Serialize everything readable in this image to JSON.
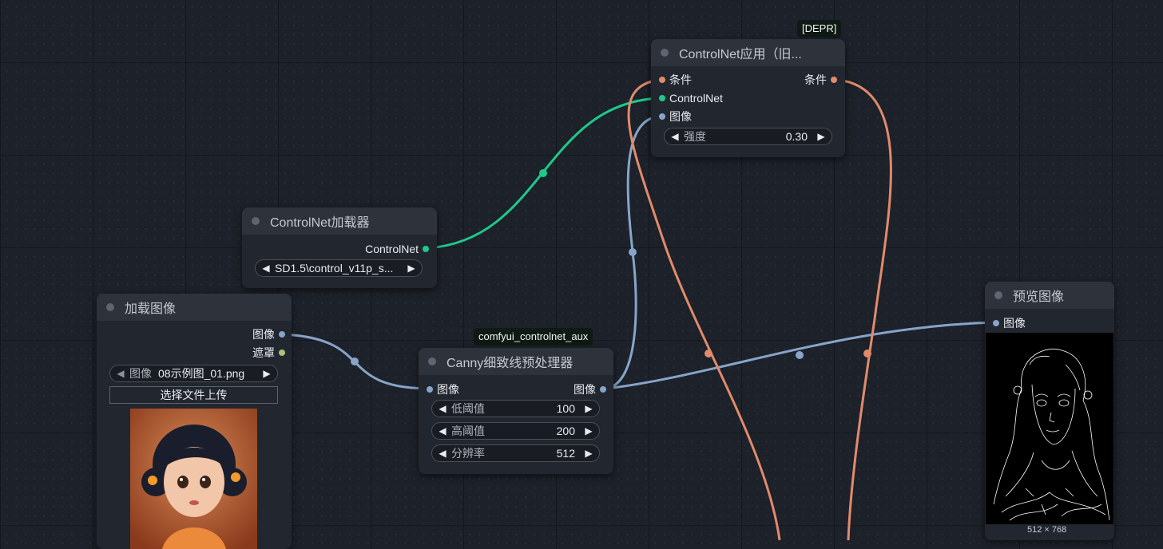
{
  "colors": {
    "conditioning": "#e08b6c",
    "controlnet": "#1ec98c",
    "image": "#86a5c8",
    "mask": "#a8c37a"
  },
  "nodes": {
    "controlnet_apply": {
      "badge": "[DEPR]",
      "title": "ControlNet应用（旧...",
      "inputs": [
        "条件",
        "ControlNet",
        "图像"
      ],
      "outputs": [
        "条件"
      ],
      "widgets": [
        {
          "label": "强度",
          "value": "0.30"
        }
      ]
    },
    "controlnet_loader": {
      "title": "ControlNet加载器",
      "outputs": [
        "ControlNet"
      ],
      "widgets": [
        {
          "label": "",
          "value": "SD1.5\\control_v11p_s..."
        }
      ]
    },
    "load_image": {
      "title": "加载图像",
      "outputs": [
        "图像",
        "遮罩"
      ],
      "widgets": [
        {
          "label": "图像",
          "value": "08示例图_01.png"
        }
      ],
      "upload_button": "选择文件上传"
    },
    "canny": {
      "badge": "comfyui_controlnet_aux",
      "title": "Canny细致线预处理器",
      "inputs": [
        "图像"
      ],
      "outputs": [
        "图像"
      ],
      "widgets": [
        {
          "label": "低阈值",
          "value": "100"
        },
        {
          "label": "高阈值",
          "value": "200"
        },
        {
          "label": "分辨率",
          "value": "512"
        }
      ]
    },
    "preview": {
      "title": "预览图像",
      "inputs": [
        "图像"
      ],
      "image_size": "512 × 768"
    }
  }
}
